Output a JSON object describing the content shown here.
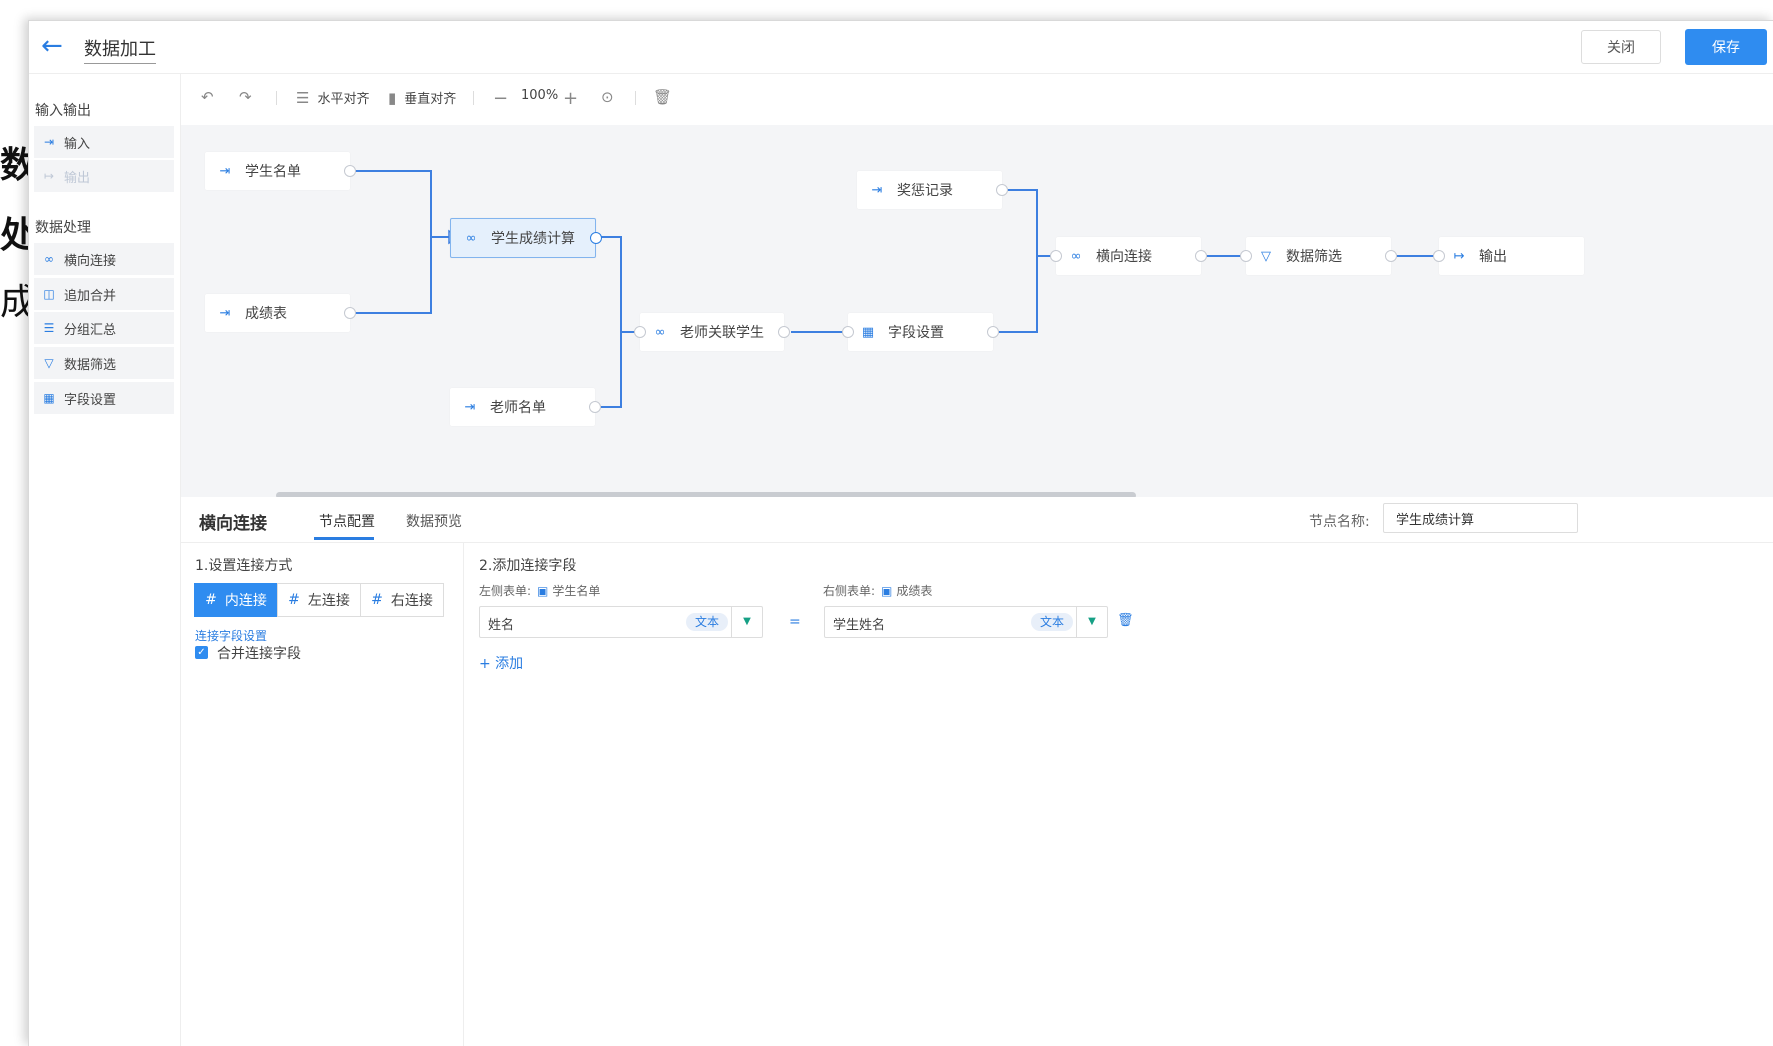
{
  "background_text": [
    "数",
    "处",
    "成"
  ],
  "header": {
    "title": "数据加工",
    "close_label": "关闭",
    "save_label": "保存"
  },
  "sidebar": {
    "section1": "输入输出",
    "io_items": [
      {
        "label": "输入",
        "icon": "input-icon",
        "enabled": true
      },
      {
        "label": "输出",
        "icon": "output-icon",
        "enabled": false
      }
    ],
    "section2": "数据处理",
    "proc_items": [
      {
        "label": "横向连接",
        "icon": "link-icon"
      },
      {
        "label": "追加合并",
        "icon": "merge-icon"
      },
      {
        "label": "分组汇总",
        "icon": "list-icon"
      },
      {
        "label": "数据筛选",
        "icon": "filter-icon"
      },
      {
        "label": "字段设置",
        "icon": "table-icon"
      }
    ]
  },
  "toolbar": {
    "align_h": "水平对齐",
    "align_v": "垂直对齐",
    "zoom": "100%"
  },
  "canvas": {
    "nodes": {
      "students": "学生名单",
      "scores": "成绩表",
      "score_calc": "学生成绩计算",
      "teachers": "老师名单",
      "teacher_student": "老师关联学生",
      "fields": "字段设置",
      "awards": "奖惩记录",
      "hjoin": "横向连接",
      "filter": "数据筛选",
      "output": "输出"
    }
  },
  "panel": {
    "title": "横向连接",
    "tabs": [
      "节点配置",
      "数据预览"
    ],
    "node_name_label": "节点名称:",
    "node_name_value": "学生成绩计算",
    "section1_title": "1.设置连接方式",
    "join_types": [
      "内连接",
      "左连接",
      "右连接"
    ],
    "active_join": "内连接",
    "join_field_settings": "连接字段设置",
    "merge_fields_label": "合并连接字段",
    "merge_fields_checked": true,
    "section2_title": "2.添加连接字段",
    "left_table_label": "左侧表单:",
    "left_table": "学生名单",
    "right_table_label": "右侧表单:",
    "right_table": "成绩表",
    "left_field": "姓名",
    "left_field_type": "文本",
    "right_field": "学生姓名",
    "right_field_type": "文本",
    "add_label": "+ 添加"
  },
  "colors": {
    "accent": "#2f8cf0",
    "canvas_bg": "#f4f5f7",
    "edge": "#3d7fe0"
  }
}
